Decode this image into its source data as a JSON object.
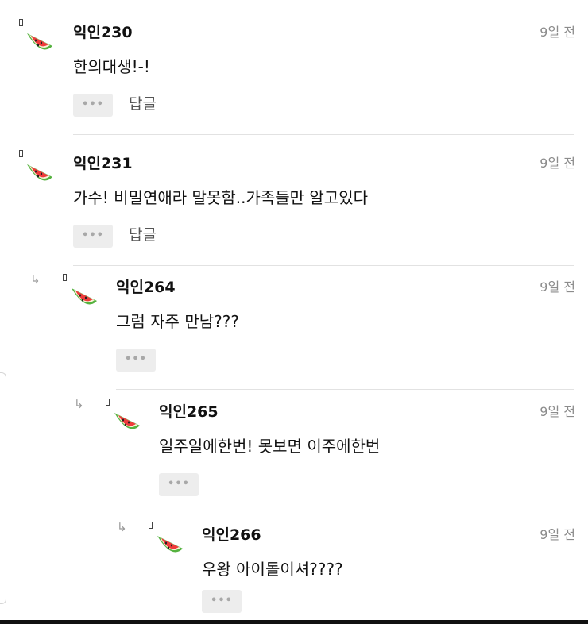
{
  "comments": [
    {
      "author": "익인230",
      "time": "9일 전",
      "text": "한의대생!-!",
      "more": "•••",
      "reply": "답글"
    },
    {
      "author": "익인231",
      "time": "9일 전",
      "text": "가수! 비밀연애라 말못함..가족들만 알고있다",
      "more": "•••",
      "reply": "답글"
    },
    {
      "author": "익인264",
      "time": "9일 전",
      "text": "그럼 자주 만남???",
      "more": "•••"
    },
    {
      "author": "익인265",
      "time": "9일 전",
      "text": "일주일에한번! 못보면 이주에한번",
      "more": "•••"
    },
    {
      "author": "익인266",
      "time": "9일 전",
      "text": "우왕 아이돌이셔????",
      "more": "•••"
    }
  ],
  "reply_arrow_glyph": "↳",
  "avatar_icon": "watermelon-icon",
  "colors": {
    "divider": "#e2e2e2",
    "time": "#8c8c8c",
    "button_bg": "#ededed"
  }
}
